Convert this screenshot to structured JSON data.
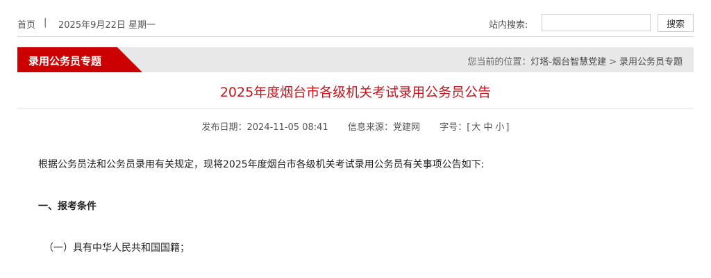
{
  "topbar": {
    "home_label": "首页",
    "separator": "|",
    "date": "2025年9月22日 星期一",
    "search_label": "站内搜索:",
    "search_value": "",
    "search_button": "搜索"
  },
  "section": {
    "tab_label": "录用公务员专题",
    "breadcrumb_prefix": "您当前的位置：",
    "breadcrumb_items": [
      "灯塔-烟台智慧党建",
      "录用公务员专题"
    ],
    "breadcrumb_arrow": ">"
  },
  "article": {
    "title": "2025年度烟台市各级机关考试录用公务员公告",
    "meta": {
      "date_label": "发布日期：",
      "date": "2024-11-05 08:41",
      "source_label": "信息来源：",
      "source": "党建网",
      "font_size_label": "字号：",
      "font_open": "[",
      "font_large": "大",
      "font_medium": "中",
      "font_small": "小",
      "font_close": "]"
    },
    "paragraph1": "根据公务员法和公务员录用有关规定，现将2025年度烟台市各级机关考试录用公务员有关事项公告如下:",
    "heading1": "一、报考条件",
    "item1": "（一）具有中华人民共和国国籍；"
  },
  "colors": {
    "accent_red": "#cc0000",
    "title_red": "#c4161c",
    "bar_gray": "#e8e8e8"
  }
}
